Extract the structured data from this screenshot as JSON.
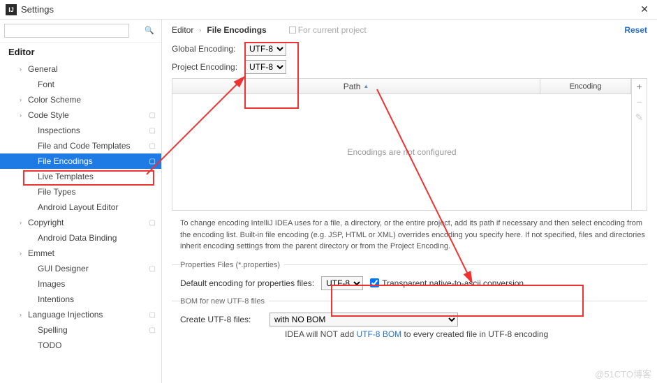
{
  "window": {
    "title": "Settings"
  },
  "sidebar": {
    "header": "Editor",
    "items": [
      {
        "label": "General",
        "depth": 1,
        "chev": true,
        "proj": false
      },
      {
        "label": "Font",
        "depth": 2,
        "chev": false,
        "proj": false
      },
      {
        "label": "Color Scheme",
        "depth": 1,
        "chev": true,
        "proj": false
      },
      {
        "label": "Code Style",
        "depth": 1,
        "chev": true,
        "proj": true
      },
      {
        "label": "Inspections",
        "depth": 2,
        "chev": false,
        "proj": true
      },
      {
        "label": "File and Code Templates",
        "depth": 2,
        "chev": false,
        "proj": true
      },
      {
        "label": "File Encodings",
        "depth": 2,
        "chev": false,
        "proj": true,
        "selected": true
      },
      {
        "label": "Live Templates",
        "depth": 2,
        "chev": false,
        "proj": false
      },
      {
        "label": "File Types",
        "depth": 2,
        "chev": false,
        "proj": false
      },
      {
        "label": "Android Layout Editor",
        "depth": 2,
        "chev": false,
        "proj": false
      },
      {
        "label": "Copyright",
        "depth": 1,
        "chev": true,
        "proj": true
      },
      {
        "label": "Android Data Binding",
        "depth": 2,
        "chev": false,
        "proj": false
      },
      {
        "label": "Emmet",
        "depth": 1,
        "chev": true,
        "proj": false
      },
      {
        "label": "GUI Designer",
        "depth": 2,
        "chev": false,
        "proj": true
      },
      {
        "label": "Images",
        "depth": 2,
        "chev": false,
        "proj": false
      },
      {
        "label": "Intentions",
        "depth": 2,
        "chev": false,
        "proj": false
      },
      {
        "label": "Language Injections",
        "depth": 1,
        "chev": true,
        "proj": true
      },
      {
        "label": "Spelling",
        "depth": 2,
        "chev": false,
        "proj": true
      },
      {
        "label": "TODO",
        "depth": 2,
        "chev": false,
        "proj": false
      }
    ]
  },
  "breadcrumb": {
    "root": "Editor",
    "leaf": "File Encodings",
    "note": "For current project",
    "reset": "Reset"
  },
  "encodings": {
    "global_label": "Global Encoding:",
    "project_label": "Project Encoding:",
    "global_value": "UTF-8",
    "project_value": "UTF-8"
  },
  "table": {
    "path_header": "Path",
    "encoding_header": "Encoding",
    "empty": "Encodings are not configured"
  },
  "explanation": "To change encoding IntelliJ IDEA uses for a file, a directory, or the entire project, add its path if necessary and then select encoding from the encoding list. Built-in file encoding (e.g. JSP, HTML or XML) overrides encoding you specify here. If not specified, files and directories inherit encoding settings from the parent directory or from the Project Encoding.",
  "properties": {
    "legend": "Properties Files (*.properties)",
    "label": "Default encoding for properties files:",
    "value": "UTF-8",
    "checkbox_label": "Transparent native-to-ascii conversion",
    "checked": true
  },
  "bom": {
    "legend": "BOM for new UTF-8 files",
    "label": "Create UTF-8 files:",
    "value": "with NO BOM",
    "note_prefix": "IDEA will NOT add ",
    "note_link": "UTF-8 BOM",
    "note_suffix": " to every created file in UTF-8 encoding"
  },
  "watermark": "@51CTO博客"
}
